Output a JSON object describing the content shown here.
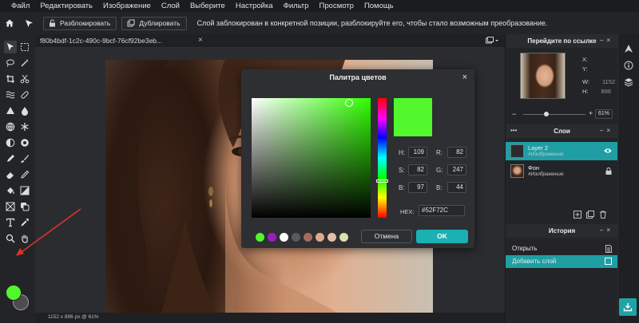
{
  "menu": [
    "Файл",
    "Редактировать",
    "Изображение",
    "Слой",
    "Выберите",
    "Настройка",
    "Фильтр",
    "Просмотр",
    "Помощь"
  ],
  "options_bar": {
    "unlock_label": "Разблокировать",
    "duplicate_label": "Дублировать",
    "message": "Слой заблокирован в конкретной позиции, разблокируйте его, чтобы стало возможным преобразование."
  },
  "document": {
    "tab_name": "f80b4bdf-1c2c-490c-9bcf-76cf92be3eb...",
    "close_glyph": "×",
    "status": "1152 x 896 px @ 61%"
  },
  "colors": {
    "foreground": "#52f72c",
    "background": "#4d4d4f",
    "accent": "#1fa3a7"
  },
  "color_dialog": {
    "title": "Палитра цветов",
    "close_glyph": "×",
    "hsb": {
      "h_label": "H:",
      "h": "109",
      "s_label": "S:",
      "s": "82",
      "b_label": "B:",
      "b": "97"
    },
    "rgb": {
      "r_label": "R:",
      "r": "82",
      "g_label": "G:",
      "g": "247",
      "b_label": "B:",
      "b": "44"
    },
    "hex_label": "HEX:",
    "hex": "#52F72C",
    "swatches": [
      "#52f72c",
      "#9b1fbf",
      "#ffffff",
      "#5a5a5a",
      "#a86a5c",
      "#e1a98d",
      "#e0c0a3",
      "#d8e2a8"
    ],
    "cancel_label": "Отмена",
    "ok_label": "OK"
  },
  "navigator": {
    "title": "Перейдите по ссылке",
    "x_label": "X:",
    "y_label": "Y:",
    "w_label": "W:",
    "w": "1152",
    "h_label": "H:",
    "h": "896",
    "zoom": "61%",
    "zoom_minus": "−",
    "zoom_plus": "+"
  },
  "layers": {
    "title": "Слои",
    "menu_glyph": "•••",
    "items": [
      {
        "name": "Layer 2",
        "sub": "#Изображение"
      },
      {
        "name": "Фон",
        "sub": "#Изображение"
      }
    ]
  },
  "history": {
    "title": "История",
    "items": [
      "Открыть",
      "Добавить слой"
    ]
  }
}
